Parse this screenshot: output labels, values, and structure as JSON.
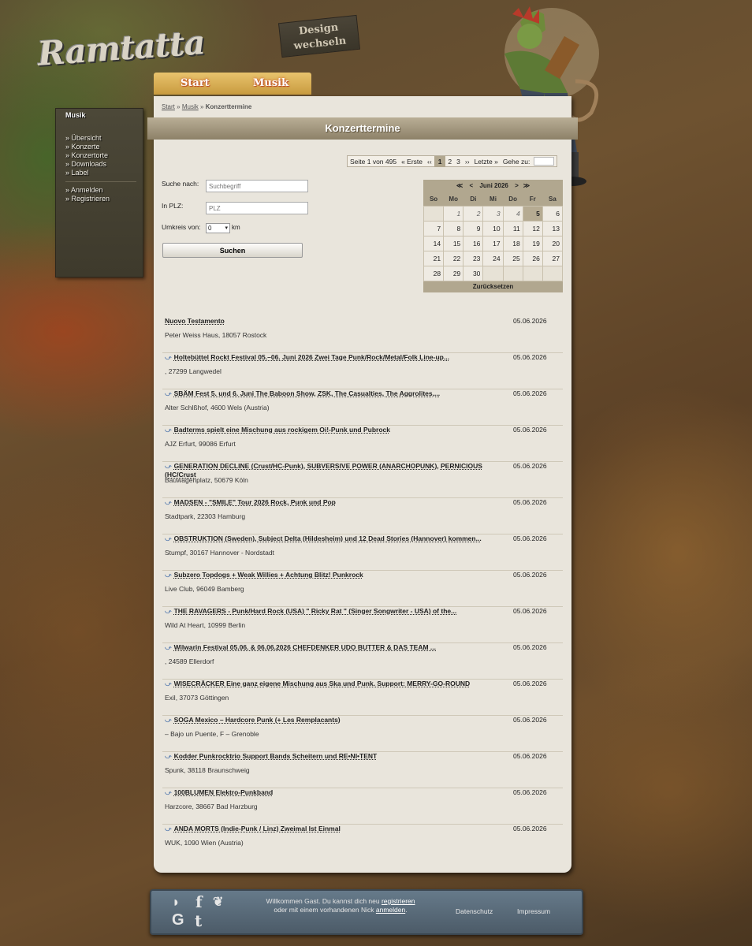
{
  "brand": {
    "logo_text": "Ramtatta",
    "design_sign_line1": "Design",
    "design_sign_line2": "wechseln"
  },
  "topnav": {
    "start": "Start",
    "musik": "Musik"
  },
  "sidebar": {
    "title": "Musik",
    "items": [
      "» Übersicht",
      "» Konzerte",
      "» Konzertorte",
      "» Downloads",
      "» Label"
    ],
    "account": [
      "» Anmelden",
      "» Registrieren"
    ]
  },
  "breadcrumb": {
    "start": "Start",
    "musik": "Musik",
    "current": "Konzerttermine",
    "sep": "»"
  },
  "page_title": "Konzerttermine",
  "pager": {
    "info": "Seite 1 von 495",
    "first": "« Erste",
    "prev": "‹‹",
    "pages": [
      "1",
      "2",
      "3"
    ],
    "next": "››",
    "last": "Letzte »",
    "goto": "Gehe zu:"
  },
  "search": {
    "label_term": "Suche nach:",
    "placeholder_term": "Suchbegriff",
    "label_plz": "In PLZ:",
    "placeholder_plz": "PLZ",
    "label_radius": "Umkreis von:",
    "radius_value": "0",
    "radius_unit": "km",
    "button": "Suchen"
  },
  "calendar": {
    "nav_prev_year": "≪",
    "nav_prev": "<",
    "month": "Juni 2026",
    "nav_next": ">",
    "nav_next_year": "≫",
    "weekdays": [
      "So",
      "Mo",
      "Di",
      "Mi",
      "Do",
      "Fr",
      "Sa"
    ],
    "weeks": [
      [
        "",
        "1",
        "2",
        "3",
        "4",
        "5",
        "6"
      ],
      [
        "7",
        "8",
        "9",
        "10",
        "11",
        "12",
        "13"
      ],
      [
        "14",
        "15",
        "16",
        "17",
        "18",
        "19",
        "20"
      ],
      [
        "21",
        "22",
        "23",
        "24",
        "25",
        "26",
        "27"
      ],
      [
        "28",
        "29",
        "30",
        "",
        "",
        "",
        ""
      ]
    ],
    "reset": "Zurücksetzen"
  },
  "events": [
    {
      "title": "Nuovo Testamento",
      "date": "05.06.2026",
      "location": "Peter Weiss Haus, 18057 Rostock",
      "icon": false
    },
    {
      "title": "Holtebüttel Rockt Festival 05.–06. Juni 2026 Zwei Tage Punk/Rock/Metal/Folk Line-up...",
      "date": "05.06.2026",
      "location": ", 27299 Langwedel",
      "icon": true
    },
    {
      "title": "SBÄM Fest 5. und 6. Juni The Baboon Show, ZSK, The Casualties, The Aggrolites,...",
      "date": "05.06.2026",
      "location": "Alter Schlßhof, 4600 Wels (Austria)",
      "icon": true
    },
    {
      "title": "Badterms spielt eine Mischung aus rockigem Oi!-Punk und Pubrock",
      "date": "05.06.2026",
      "location": "AJZ Erfurt, 99086 Erfurt",
      "icon": true
    },
    {
      "title": "GENERATION DECLINE (Crust/HC-Punk), SUBVERSIVE POWER (ANARCHOPUNK), PERNICIOUS (HC/Crust",
      "date": "05.06.2026",
      "location": "Bauwagenplatz, 50679 Köln",
      "icon": true
    },
    {
      "title": "MADSEN - \"SMILE\" Tour 2026 Rock, Punk und Pop",
      "date": "05.06.2026",
      "location": "Stadtpark, 22303 Hamburg",
      "icon": true
    },
    {
      "title": "OBSTRUKTION (Sweden), Subject Delta (Hildesheim) und 12 Dead Stories (Hannover) kommen...",
      "date": "05.06.2026",
      "location": "Stumpf, 30167 Hannover - Nordstadt",
      "icon": true
    },
    {
      "title": "Subzero Topdogs + Weak Willies + Achtung Blitz! Punkrock",
      "date": "05.06.2026",
      "location": "Live Club, 96049 Bamberg",
      "icon": true
    },
    {
      "title": "THE RAVAGERS - Punk/Hard Rock (USA) \" Ricky Rat \" (Singer Songwriter - USA) of the...",
      "date": "05.06.2026",
      "location": "Wild At Heart, 10999 Berlin",
      "icon": true
    },
    {
      "title": "Wilwarin Festival 05.06. & 06.06.2026 CHEFDENKER UDO BUTTER & DAS TEAM ...",
      "date": "05.06.2026",
      "location": ", 24589 Ellerdorf",
      "icon": true
    },
    {
      "title": "WISECRÄCKER Eine ganz eigene Mischung aus Ska und Punk. Support: MERRY-GO-ROUND",
      "date": "05.06.2026",
      "location": "Exil, 37073 Göttingen",
      "icon": true
    },
    {
      "title": "SOGA Mexico – Hardcore Punk (+ Les Remplacants)",
      "date": "05.06.2026",
      "location": "– Bajo un Puente, F – Grenoble",
      "icon": true
    },
    {
      "title": "Kodder Punkrocktrio Support Bands Scheitern und RE•NI•TENT",
      "date": "05.06.2026",
      "location": "Spunk, 38118 Braunschweig",
      "icon": true
    },
    {
      "title": "100BLUMEN Elektro-Punkband",
      "date": "05.06.2026",
      "location": "Harzcore, 38667 Bad Harzburg",
      "icon": true
    },
    {
      "title": "ANDA MORTS (Indie-Punk / Linz) Zweimal Ist Einmal",
      "date": "05.06.2026",
      "location": "WUK, 1090 Wien (Austria)",
      "icon": true
    }
  ],
  "footer": {
    "welcome_line1": "Willkommen Gast. Du kannst dich neu",
    "register": "registrieren",
    "welcome_line2": "oder mit einem vorhandenen Nick",
    "login": "anmelden",
    "period": ".",
    "datenschutz": "Datenschutz",
    "impressum": "Impressum",
    "icons": [
      "rss-icon",
      "facebook-icon",
      "twitter-icon",
      "google-icon",
      "tumblr-icon"
    ]
  },
  "colors": {
    "panel": "#e9e5dc",
    "title_bar": "#a09478",
    "calendar": "#b1a78f",
    "footer": "#5a6b78",
    "nav_gold": "#d9b35a"
  }
}
